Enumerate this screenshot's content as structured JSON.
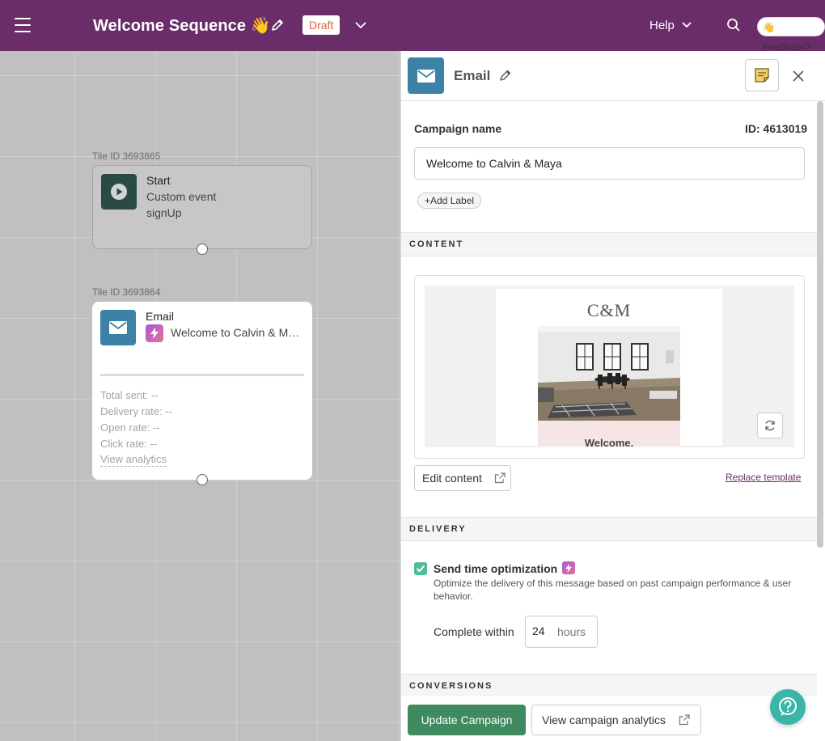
{
  "topbar": {
    "title": "Welcome Sequence 👋",
    "status": "Draft",
    "help_label": "Help",
    "feedback_label": "👋 Feedback?"
  },
  "canvas": {
    "start_tile": {
      "tile_id": "Tile ID 3693865",
      "heading": "Start",
      "line1": "Custom event",
      "line2": "signUp"
    },
    "email_tile": {
      "tile_id": "Tile ID 3693864",
      "heading": "Email",
      "subject": "Welcome to Calvin & Maya",
      "stats": {
        "total_sent": "Total sent:  --",
        "delivery_rate": "Delivery rate:  --",
        "open_rate": "Open rate:  --",
        "click_rate": "Click rate:  --"
      },
      "analytics_link": "View analytics"
    }
  },
  "panel": {
    "title": "Email",
    "campaign_name_label": "Campaign name",
    "campaign_id": "ID: 4613019",
    "campaign_name_value": "Welcome to Calvin & Maya",
    "add_label": "+Add Label",
    "sections": {
      "content": "CONTENT",
      "delivery": "DELIVERY",
      "conversions": "CONVERSIONS"
    },
    "preview": {
      "logo": "C&M",
      "welcome_text": "Welcome."
    },
    "edit_content": "Edit content",
    "replace_template": "Replace template",
    "send_time": {
      "label": "Send time optimization",
      "description": "Optimize the delivery of this message based on past campaign performance & user behavior.",
      "checked": true,
      "complete_within_label": "Complete within",
      "hours_value": "24",
      "hours_unit": "hours"
    },
    "footer": {
      "update_button": "Update Campaign",
      "analytics_button": "View campaign analytics"
    }
  },
  "colors": {
    "topbar": "#6b2c6a",
    "draft_text": "#e0623b",
    "email_icon": "#3d82a6",
    "start_icon": "#2b4a43",
    "update_button": "#3f8a5e",
    "checkbox": "#4fbc99",
    "help_fab": "#3ab5a6"
  }
}
